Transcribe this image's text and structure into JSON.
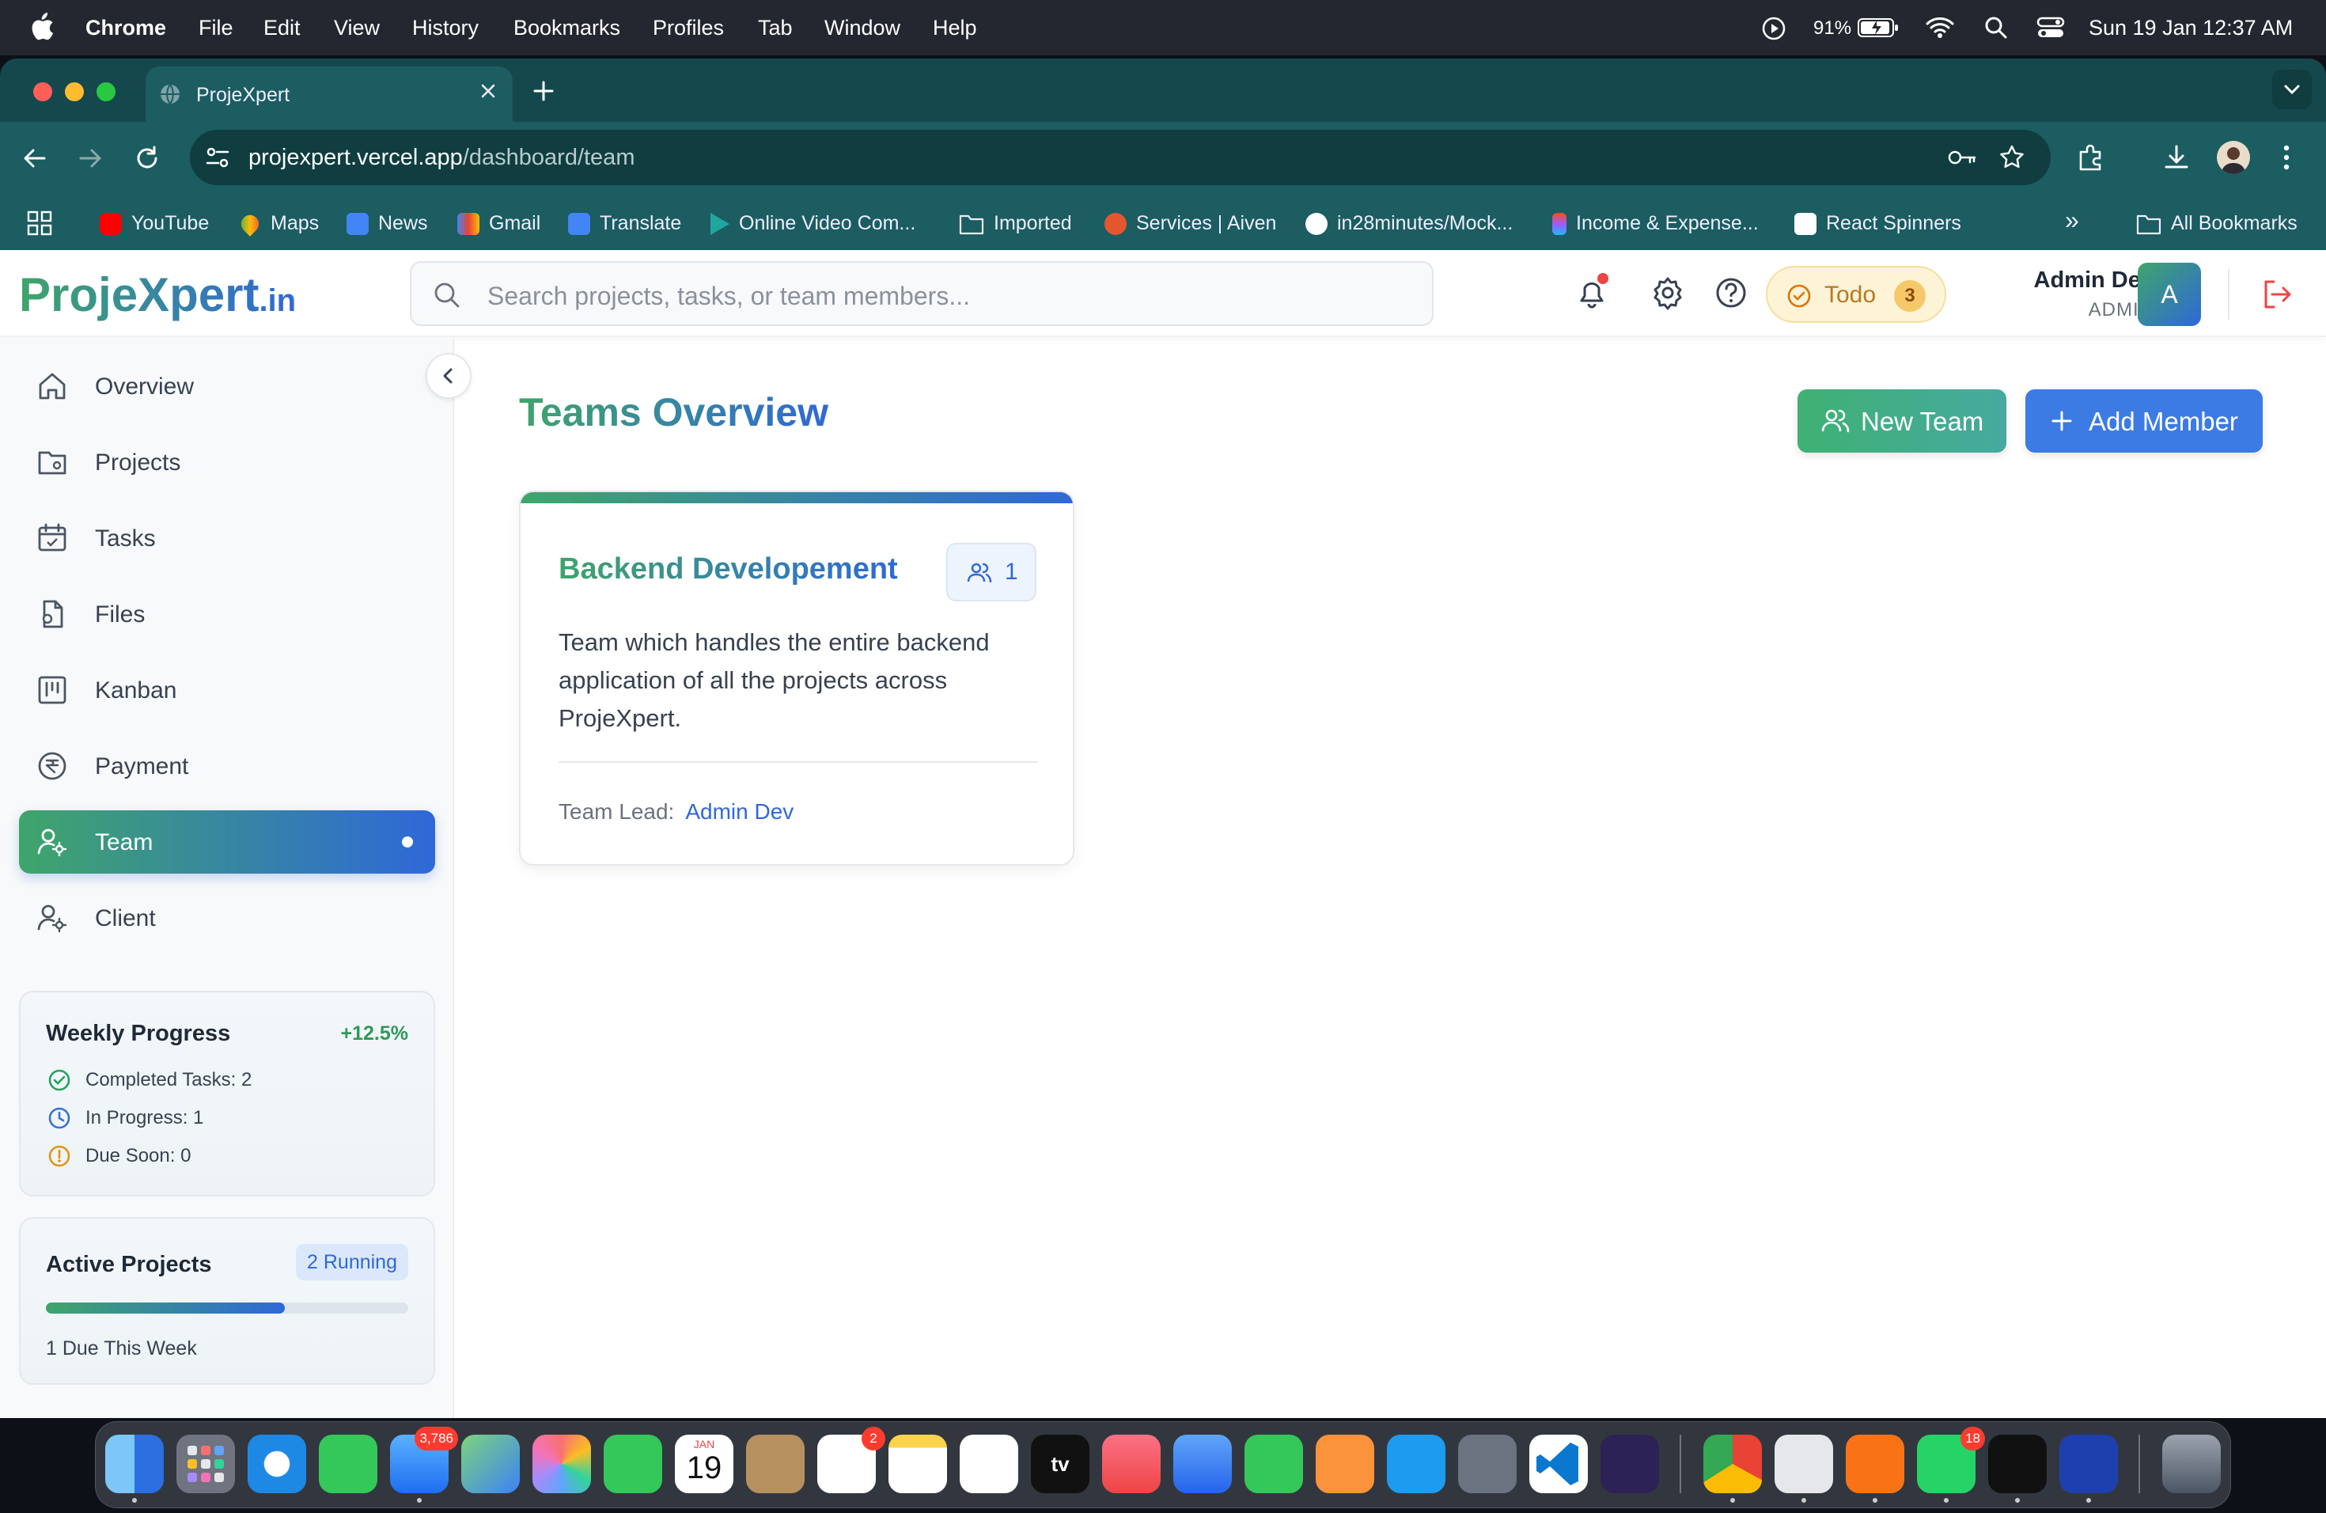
{
  "menubar": {
    "items": [
      "Chrome",
      "File",
      "Edit",
      "View",
      "History",
      "Bookmarks",
      "Profiles",
      "Tab",
      "Window",
      "Help"
    ],
    "battery": "91%",
    "datetime": "Sun 19 Jan  12:37 AM"
  },
  "browser": {
    "tab_title": "ProjeXpert",
    "url_host": "projexpert.vercel.app",
    "url_path": "/dashboard/team",
    "bookmarks": [
      "YouTube",
      "Maps",
      "News",
      "Gmail",
      "Translate",
      "Online Video Com...",
      "Imported",
      "Services | Aiven",
      "in28minutes/Mock...",
      "Income & Expense...",
      "React Spinners"
    ],
    "all_bookmarks": "All Bookmarks",
    "overflow": "»"
  },
  "header": {
    "logo_main": "ProjeXpert",
    "logo_suffix": ".in",
    "search_placeholder": "Search projects, tasks, or team members...",
    "todo_label": "Todo",
    "todo_count": "3",
    "user_name": "Admin Dev",
    "user_role": "ADMIN",
    "avatar_initial": "A"
  },
  "sidebar": {
    "items": [
      {
        "label": "Overview",
        "icon": "home-icon"
      },
      {
        "label": "Projects",
        "icon": "folder-icon"
      },
      {
        "label": "Tasks",
        "icon": "calendar-icon"
      },
      {
        "label": "Files",
        "icon": "file-icon"
      },
      {
        "label": "Kanban",
        "icon": "kanban-icon"
      },
      {
        "label": "Payment",
        "icon": "rupee-icon"
      },
      {
        "label": "Team",
        "icon": "user-cog-icon"
      },
      {
        "label": "Client",
        "icon": "user-cog-icon"
      }
    ],
    "active": "Team",
    "weekly_progress": {
      "title": "Weekly Progress",
      "change": "+12.5%",
      "rows": [
        "Completed Tasks: 2",
        "In Progress: 1",
        "Due Soon: 0"
      ]
    },
    "active_projects": {
      "title": "Active Projects",
      "badge": "2 Running",
      "progress": 0.66,
      "footer": "1 Due This Week"
    }
  },
  "main": {
    "title": "Teams Overview",
    "new_team_label": "New Team",
    "add_member_label": "Add Member",
    "team": {
      "name": "Backend Developement",
      "member_count": "1",
      "description": "Team which handles the entire backend application of all the projects across ProjeXpert.",
      "lead_label": "Team Lead:",
      "lead_name": "Admin Dev"
    }
  },
  "dock": {
    "mail_badge": "3,786",
    "reminders_badge": "2",
    "whatsapp_badge": "18",
    "calendar_month": "JAN",
    "calendar_day": "19",
    "tv_label": "tv"
  },
  "colors": {
    "brand_green": "#3fa56a",
    "brand_blue": "#2f68d8",
    "browser_theme": "#1b5d61"
  }
}
